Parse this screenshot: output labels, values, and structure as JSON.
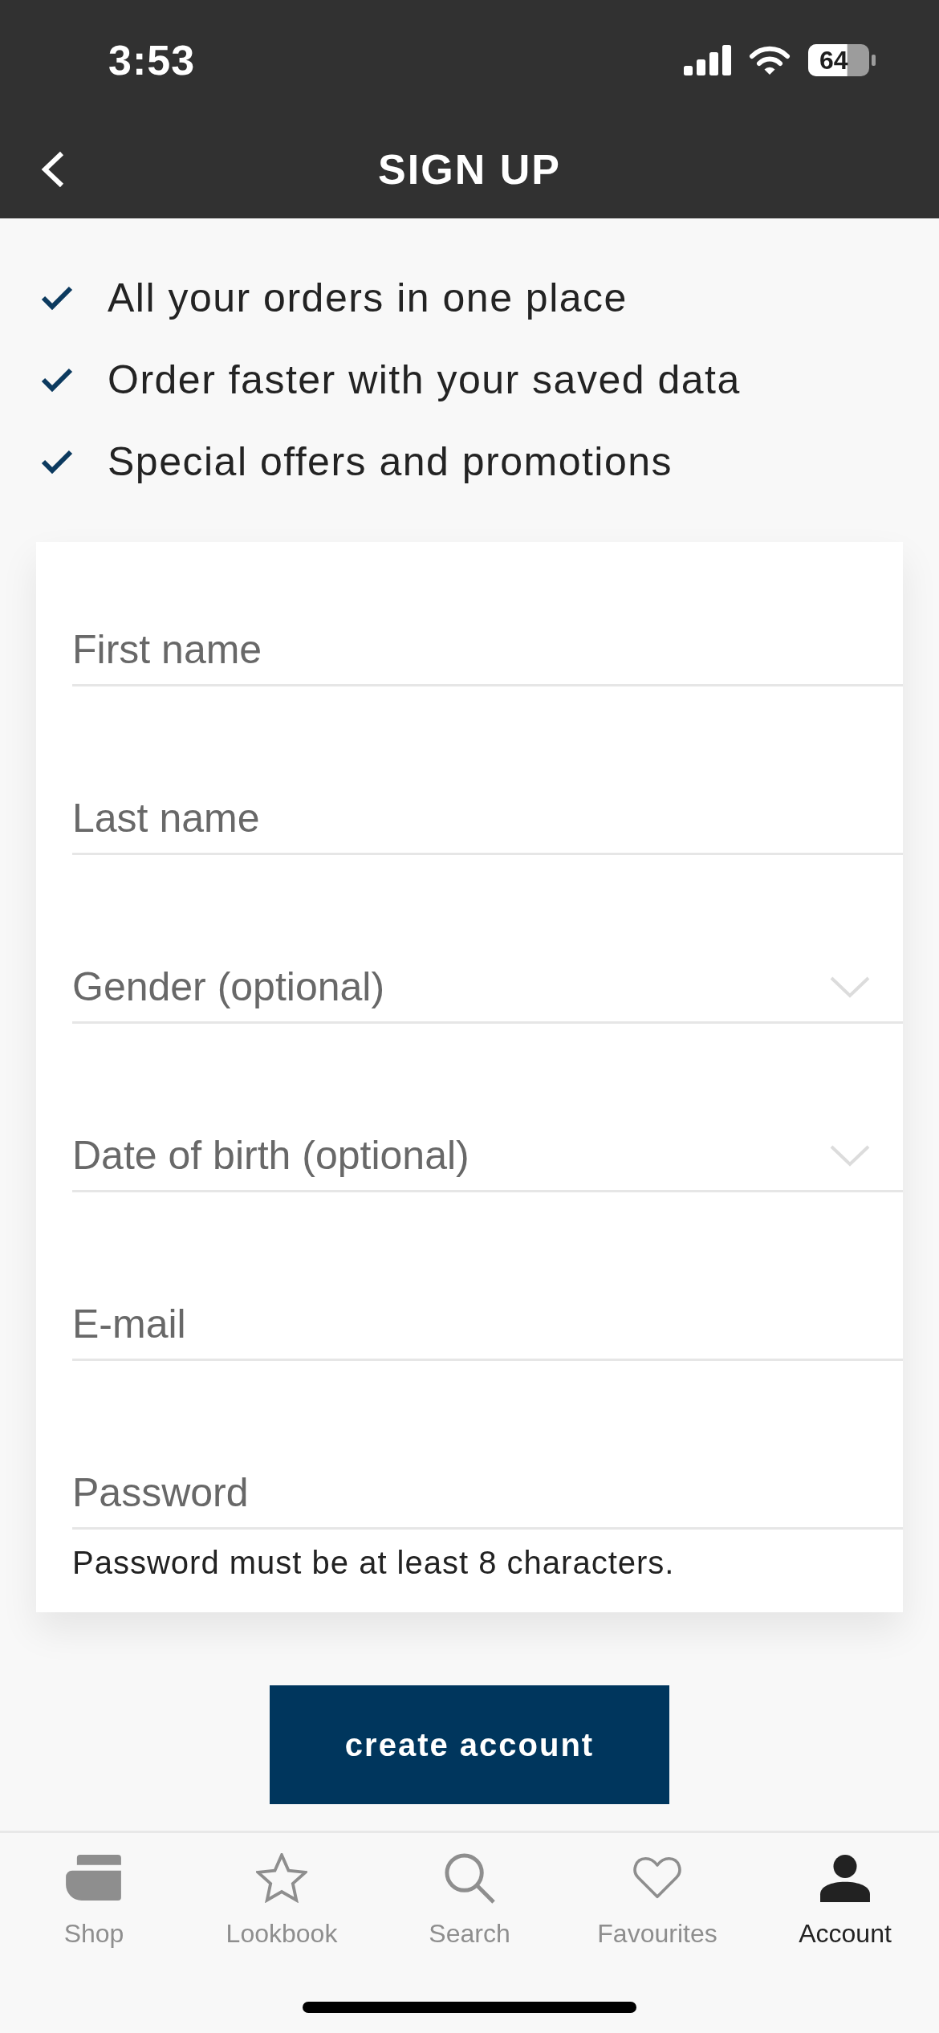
{
  "status_bar": {
    "time": "3:53",
    "battery": "64"
  },
  "header": {
    "title": "SIGN UP"
  },
  "benefits": [
    "All your orders in one place",
    "Order faster with your saved data",
    "Special offers and promotions"
  ],
  "form": {
    "fields": [
      {
        "kind": "text",
        "placeholder": "First name"
      },
      {
        "kind": "text",
        "placeholder": "Last name"
      },
      {
        "kind": "select",
        "placeholder": "Gender (optional)"
      },
      {
        "kind": "select",
        "placeholder": "Date of birth (optional)"
      },
      {
        "kind": "text",
        "placeholder": "E-mail"
      },
      {
        "kind": "text",
        "placeholder": "Password",
        "hint": "Password must be at least 8 characters."
      }
    ]
  },
  "submit_button": {
    "label": "create account"
  },
  "tab_bar": [
    {
      "label": "Shop",
      "selected": false
    },
    {
      "label": "Lookbook",
      "selected": false
    },
    {
      "label": "Search",
      "selected": false
    },
    {
      "label": "Favourites",
      "selected": false
    },
    {
      "label": "Account",
      "selected": true
    }
  ]
}
